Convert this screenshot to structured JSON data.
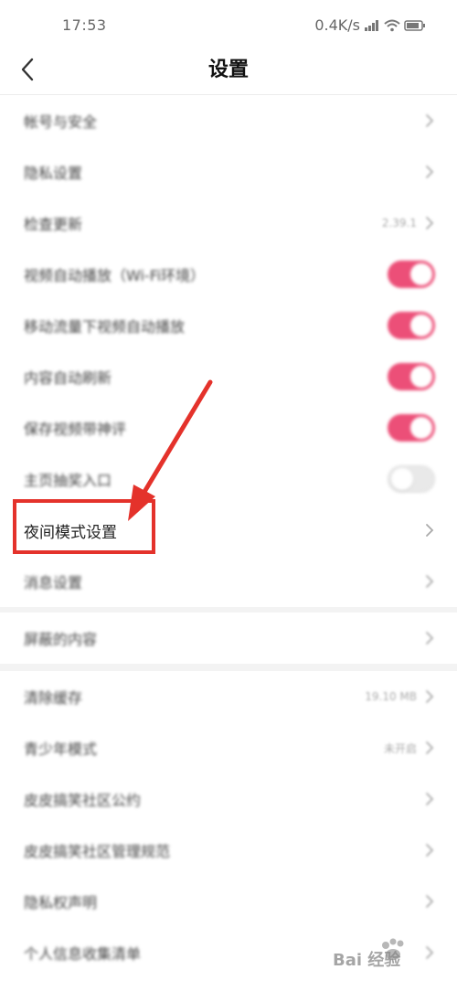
{
  "status_bar": {
    "time": "17:53",
    "network_speed": "0.4K/s",
    "signal_icon": "signal-bars-icon",
    "wifi_icon": "wifi-icon",
    "battery_icon": "battery-icon"
  },
  "header": {
    "back_icon": "chevron-left-icon",
    "title": "设置"
  },
  "group1": [
    {
      "label": "帐号与安全",
      "control": "chevron"
    },
    {
      "label": "隐私设置",
      "control": "chevron"
    },
    {
      "label": "检查更新",
      "value": "2.39.1",
      "control": "chevron"
    },
    {
      "label": "视频自动播放（Wi-Fi环境）",
      "control": "toggle",
      "on": true
    },
    {
      "label": "移动流量下视频自动播放",
      "control": "toggle",
      "on": true
    },
    {
      "label": "内容自动刷新",
      "control": "toggle",
      "on": true
    },
    {
      "label": "保存视频带神评",
      "control": "toggle",
      "on": true
    },
    {
      "label": "主页抽奖入口",
      "control": "toggle",
      "on": false
    },
    {
      "label": "夜间模式设置",
      "control": "chevron",
      "highlighted": true
    },
    {
      "label": "消息设置",
      "control": "chevron"
    }
  ],
  "group2": [
    {
      "label": "屏蔽的内容",
      "control": "chevron"
    }
  ],
  "group3": [
    {
      "label": "清除缓存",
      "value": "19.10 MB",
      "control": "chevron"
    },
    {
      "label": "青少年模式",
      "value": "未开启",
      "control": "chevron"
    },
    {
      "label": "皮皮搞笑社区公约",
      "control": "chevron"
    },
    {
      "label": "皮皮搞笑社区管理规范",
      "control": "chevron"
    },
    {
      "label": "隐私权声明",
      "control": "chevron"
    },
    {
      "label": "个人信息收集清单",
      "control": "chevron"
    }
  ],
  "colors": {
    "toggle_on": "#ec4f78",
    "annotation_red": "#e4322b"
  },
  "watermark": {
    "text": "Bai 经验",
    "logo_icon": "paw-logo-icon"
  }
}
